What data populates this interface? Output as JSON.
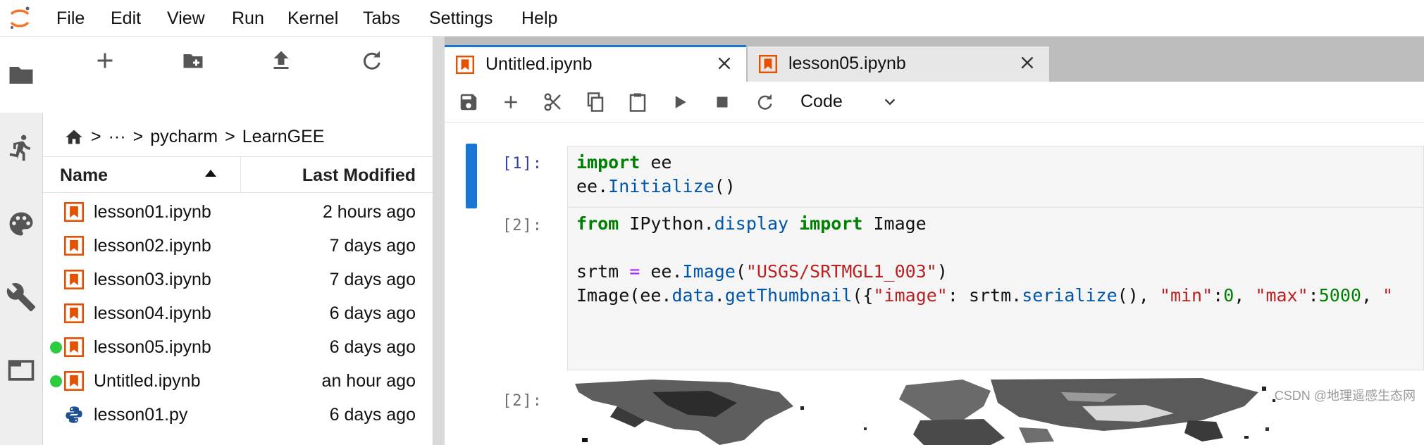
{
  "menubar": {
    "items": [
      "File",
      "Edit",
      "View",
      "Run",
      "Kernel",
      "Tabs",
      "Settings",
      "Help"
    ]
  },
  "activity_bar": {
    "icons": [
      "folder-icon",
      "running-icon",
      "palette-icon",
      "wrench-icon",
      "tabs-icon"
    ]
  },
  "file_browser": {
    "toolbar": [
      "new-launcher-icon",
      "new-folder-icon",
      "upload-icon",
      "refresh-icon"
    ],
    "breadcrumbs": {
      "home": "home-icon",
      "ellipsis": "···",
      "parts": [
        "pycharm",
        "LearnGEE"
      ],
      "sep": ">"
    },
    "columns": {
      "name": "Name",
      "modified": "Last Modified"
    },
    "files": [
      {
        "name": "lesson01.ipynb",
        "modified": "2 hours ago",
        "type": "notebook",
        "running": false
      },
      {
        "name": "lesson02.ipynb",
        "modified": "7 days ago",
        "type": "notebook",
        "running": false
      },
      {
        "name": "lesson03.ipynb",
        "modified": "7 days ago",
        "type": "notebook",
        "running": false
      },
      {
        "name": "lesson04.ipynb",
        "modified": "6 days ago",
        "type": "notebook",
        "running": false
      },
      {
        "name": "lesson05.ipynb",
        "modified": "6 days ago",
        "type": "notebook",
        "running": true
      },
      {
        "name": "Untitled.ipynb",
        "modified": "an hour ago",
        "type": "notebook",
        "running": true
      },
      {
        "name": "lesson01.py",
        "modified": "6 days ago",
        "type": "python",
        "running": false
      }
    ]
  },
  "tabs": [
    {
      "label": "Untitled.ipynb",
      "active": true
    },
    {
      "label": "lesson05.ipynb",
      "active": false
    }
  ],
  "notebook_toolbar": {
    "icons": [
      "save-icon",
      "add-cell-icon",
      "cut-icon",
      "copy-icon",
      "paste-icon",
      "run-icon",
      "stop-icon",
      "restart-icon"
    ],
    "cell_type": "Code"
  },
  "cells": {
    "cell1": {
      "prompt": "[1]:",
      "line1": {
        "kw": "import",
        "rest": " ee"
      },
      "line2": {
        "a": "ee.",
        "fn": "Initialize",
        "b": "()"
      }
    },
    "cell2": {
      "prompt": "[2]:",
      "line1": {
        "kw1": "from",
        "a": " IPython.",
        "fn": "display",
        "b": " ",
        "kw2": "import",
        "c": " Image"
      },
      "line3": {
        "a": "srtm ",
        "op": "=",
        "b": " ee.",
        "fn": "Image",
        "c": "(",
        "str": "\"USGS/SRTMGL1_003\"",
        "d": ")"
      },
      "line4": {
        "a": "Image(ee.",
        "fn1": "data",
        "b": ".",
        "fn2": "getThumbnail",
        "c": "({",
        "s1": "\"image\"",
        "d": ": srtm.",
        "fn3": "serialize",
        "e": "(), ",
        "s2": "\"min\"",
        "f": ":",
        "n1": "0",
        "g": ", ",
        "s3": "\"max\"",
        "h": ":",
        "n2": "5000",
        "i": ", ",
        "s4": "\""
      }
    },
    "output": {
      "prompt": "[2]:"
    }
  },
  "watermark": "CSDN @地理遥感生态网",
  "colors": {
    "accent": "#1976d2",
    "notebook_icon": "#e65100",
    "running_dot": "#2ecc40",
    "python_icon": "#1e4f91"
  }
}
